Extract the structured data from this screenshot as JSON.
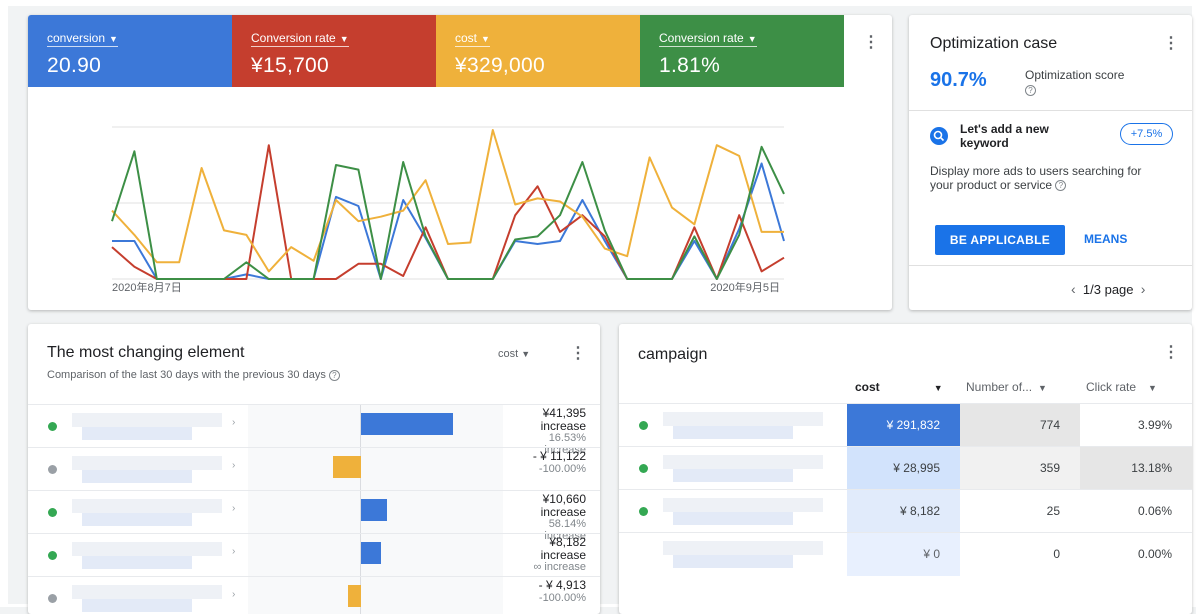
{
  "metrics": [
    {
      "label": "conversion",
      "value": "20.90",
      "color": "#3c78d8"
    },
    {
      "label": "Conversion rate",
      "value": "¥15,700",
      "color": "#c53e2e"
    },
    {
      "label": "cost",
      "value": "¥329,000",
      "color": "#efb13b"
    },
    {
      "label": "Conversion rate",
      "value": "1.81%",
      "color": "#3d8f46"
    }
  ],
  "chart_data": {
    "type": "line",
    "x_start_label": "2020年8月7日",
    "x_end_label": "2020年9月5日",
    "points": 30,
    "series": [
      {
        "color": "#3c78d8",
        "values": [
          2.5,
          2.5,
          0,
          0,
          0,
          0,
          0.3,
          0,
          0,
          0,
          5.4,
          4.8,
          0,
          5.2,
          2.7,
          0,
          0,
          0,
          2.5,
          2.3,
          2.5,
          5.2,
          2.5,
          0,
          0,
          0,
          2.5,
          0,
          3.3,
          7.6,
          2.5
        ]
      },
      {
        "color": "#c53e2e",
        "values": [
          2.1,
          0.8,
          0,
          0,
          0,
          0,
          0,
          8.8,
          0,
          0,
          0,
          1.0,
          1.0,
          0.2,
          3.4,
          0,
          0,
          0,
          4.2,
          6.1,
          3.1,
          4.2,
          2.8,
          0,
          0,
          0,
          3.4,
          0,
          4.2,
          0.5,
          1.4
        ]
      },
      {
        "color": "#efb13b",
        "values": [
          4.5,
          2.9,
          1.1,
          1.1,
          7.3,
          3.2,
          2.9,
          0.5,
          2.1,
          1.2,
          5.2,
          3.8,
          4.1,
          4.5,
          6.5,
          2.3,
          2.4,
          9.8,
          4.9,
          5.3,
          5.1,
          4.1,
          2.0,
          1.5,
          8.0,
          4.7,
          3.6,
          8.8,
          8.1,
          3.1,
          3.1
        ]
      },
      {
        "color": "#3d8f46",
        "values": [
          3.8,
          8.4,
          0,
          0,
          0,
          0,
          1.1,
          0,
          0,
          0,
          7.5,
          7.2,
          0,
          7.7,
          2.8,
          0,
          0,
          0,
          2.6,
          2.8,
          4.2,
          7.7,
          3.2,
          0,
          0,
          0,
          2.8,
          0,
          2.9,
          8.7,
          5.6
        ]
      }
    ],
    "ylim": [
      0,
      10
    ],
    "grid": true
  },
  "optimization": {
    "title": "Optimization case",
    "score": "90.7%",
    "score_label": "Optimization score",
    "recommendation_title": "Let's add a new keyword",
    "badge": "+7.5%",
    "description": "Display more ads to users searching for your product or service",
    "apply_label": "BE APPLICABLE",
    "means_label": "MEANS",
    "pager": "1/3 page"
  },
  "changes": {
    "title": "The most changing element",
    "subtitle": "Comparison of the last 30 days with the previous 30 days",
    "metric_select": "cost",
    "rows": [
      {
        "value": "¥41,395",
        "word": "increase",
        "pct": "16.53%",
        "pct_word": "increase",
        "dot": "#34a853",
        "bar_color": "#3c78d8",
        "bar_share": 0.36
      },
      {
        "value": "- ¥ 11,122",
        "word": "",
        "pct": "-100.00%",
        "pct_word": "",
        "dot": "#9aa0a6",
        "bar_color": "#efb13b",
        "bar_share": -0.11
      },
      {
        "value": "¥10,660",
        "word": "increase",
        "pct": "58.14%",
        "pct_word": "increase",
        "dot": "#34a853",
        "bar_color": "#3c78d8",
        "bar_share": 0.1
      },
      {
        "value": "¥8,182",
        "word": "increase",
        "pct": "",
        "pct_word": "∞ increase",
        "dot": "#34a853",
        "bar_color": "#3c78d8",
        "bar_share": 0.08
      },
      {
        "value": "- ¥ 4,913",
        "word": "",
        "pct": "-100.00%",
        "pct_word": "",
        "dot": "#9aa0a6",
        "bar_color": "#efb13b",
        "bar_share": -0.05
      }
    ]
  },
  "campaign": {
    "title": "campaign",
    "col_cost": "cost",
    "col_number": "Number of...",
    "col_click": "Click rate",
    "rows": [
      {
        "cost": "¥ 291,832",
        "number": "774",
        "click": "3.99%",
        "dot": "#34a853"
      },
      {
        "cost": "¥ 28,995",
        "number": "359",
        "click": "13.18%",
        "dot": "#34a853"
      },
      {
        "cost": "¥ 8,182",
        "number": "25",
        "click": "0.06%",
        "dot": "#34a853"
      },
      {
        "cost": "¥ 0",
        "number": "0",
        "click": "0.00%",
        "dot": ""
      }
    ]
  }
}
